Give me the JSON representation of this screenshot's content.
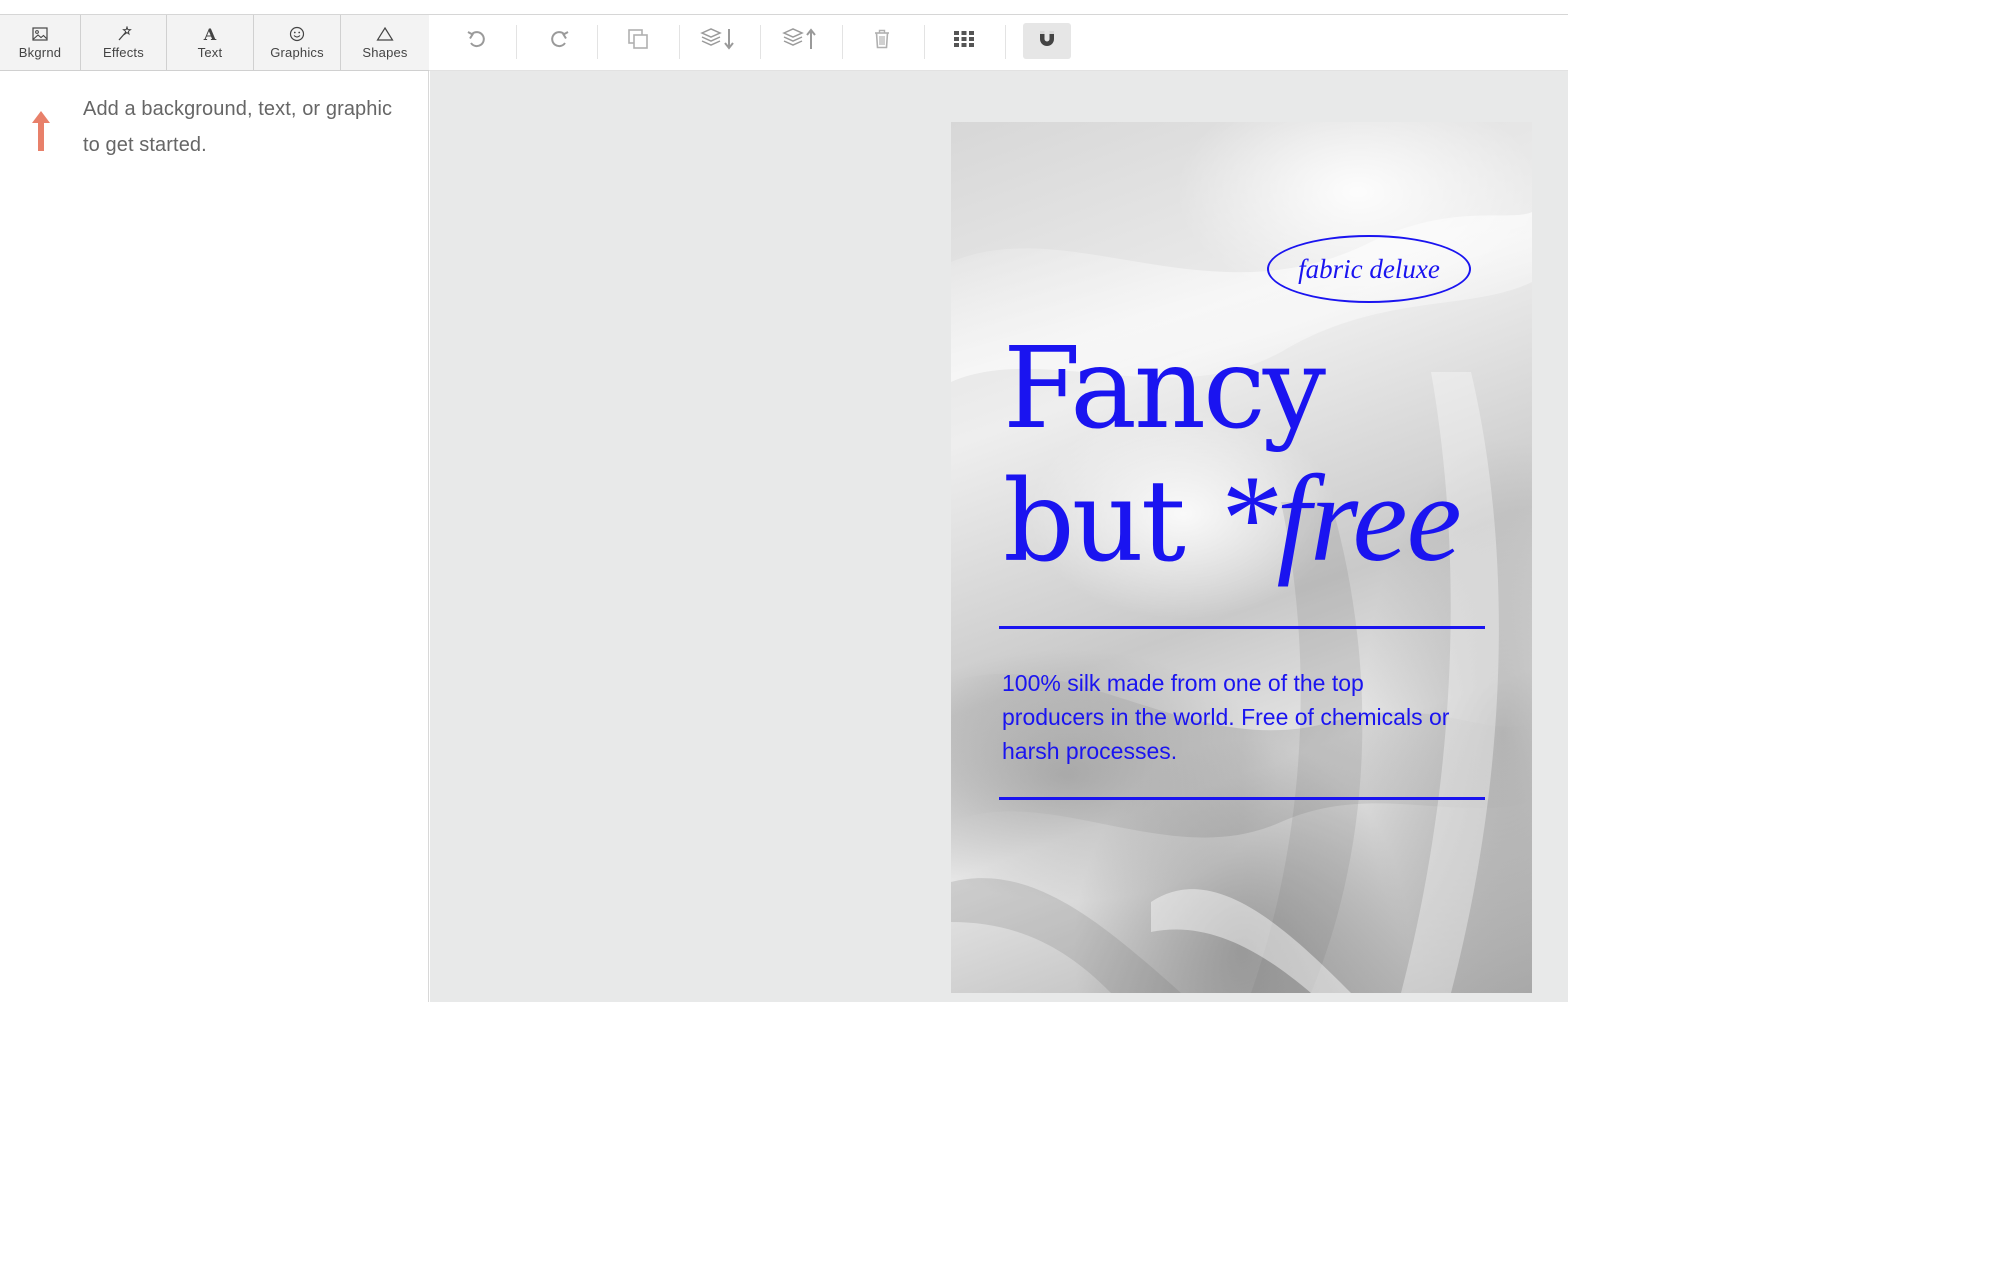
{
  "tool_tabs": [
    {
      "label": "Bkgrnd",
      "icon": "image-icon"
    },
    {
      "label": "Effects",
      "icon": "magic-wand-icon"
    },
    {
      "label": "Text",
      "icon": "text-a-icon"
    },
    {
      "label": "Graphics",
      "icon": "smiley-icon"
    },
    {
      "label": "Shapes",
      "icon": "triangle-icon"
    }
  ],
  "toolbar": {
    "buttons": [
      {
        "name": "undo",
        "icon": "undo-icon"
      },
      {
        "name": "redo",
        "icon": "redo-icon"
      },
      {
        "name": "duplicate",
        "icon": "duplicate-icon"
      },
      {
        "name": "send-backward",
        "icon": "layer-down-icon"
      },
      {
        "name": "bring-forward",
        "icon": "layer-up-icon"
      },
      {
        "name": "delete",
        "icon": "trash-icon"
      },
      {
        "name": "grid",
        "icon": "grid-icon"
      },
      {
        "name": "snap",
        "icon": "magnet-icon",
        "active": true
      }
    ]
  },
  "left_panel": {
    "hint": "Add a background, text, or graphic to get started."
  },
  "poster": {
    "badge": "fabric deluxe",
    "headline_line1": "Fancy",
    "headline_line2_prefix": "but ",
    "headline_line2_italic": "*free",
    "body": "100% silk made from one of the top producers in the world. Free of chemicals or harsh processes."
  },
  "colors": {
    "accent_blue": "#1a14f0",
    "hint_arrow": "#e8806a",
    "workspace_bg": "#e8e9e9"
  }
}
